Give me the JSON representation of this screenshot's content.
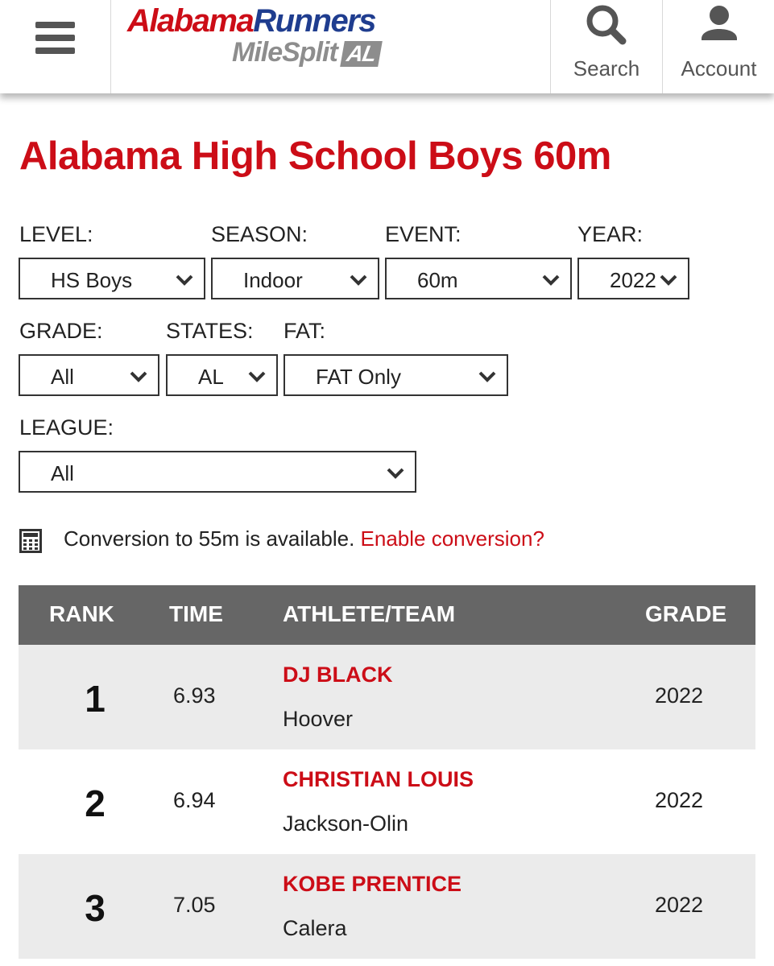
{
  "header": {
    "logo_line1_a": "Alabama",
    "logo_line1_b": "Runners",
    "logo_line2": "MileSplit",
    "logo_badge": "AL",
    "search_label": "Search",
    "account_label": "Account"
  },
  "page_title": "Alabama High School Boys 60m",
  "filters": {
    "level": {
      "label": "LEVEL:",
      "value": "HS Boys"
    },
    "season": {
      "label": "SEASON:",
      "value": "Indoor"
    },
    "event": {
      "label": "EVENT:",
      "value": "60m"
    },
    "year": {
      "label": "YEAR:",
      "value": "2022"
    },
    "grade": {
      "label": "GRADE:",
      "value": "All"
    },
    "states": {
      "label": "STATES:",
      "value": "AL"
    },
    "fat": {
      "label": "FAT:",
      "value": "FAT Only"
    },
    "league": {
      "label": "LEAGUE:",
      "value": "All"
    }
  },
  "conversion": {
    "text": "Conversion to 55m is available.",
    "link": "Enable conversion?"
  },
  "table": {
    "columns": [
      "RANK",
      "TIME",
      "ATHLETE/TEAM",
      "GRADE"
    ],
    "rows": [
      {
        "rank": "1",
        "time": "6.93",
        "athlete": "DJ BLACK",
        "team": "Hoover",
        "grade": "2022"
      },
      {
        "rank": "2",
        "time": "6.94",
        "athlete": "CHRISTIAN LOUIS",
        "team": "Jackson-Olin",
        "grade": "2022"
      },
      {
        "rank": "3",
        "time": "7.05",
        "athlete": "KOBE PRENTICE",
        "team": "Calera",
        "grade": "2022"
      }
    ]
  },
  "colors": {
    "accent_red": "#cc0d17",
    "logo_blue": "#1f3d8f",
    "table_header": "#666666",
    "row_shade": "#ebebeb"
  },
  "icons": [
    "hamburger-menu-icon",
    "search-icon",
    "account-icon",
    "chevron-down-icon",
    "calculator-icon"
  ]
}
